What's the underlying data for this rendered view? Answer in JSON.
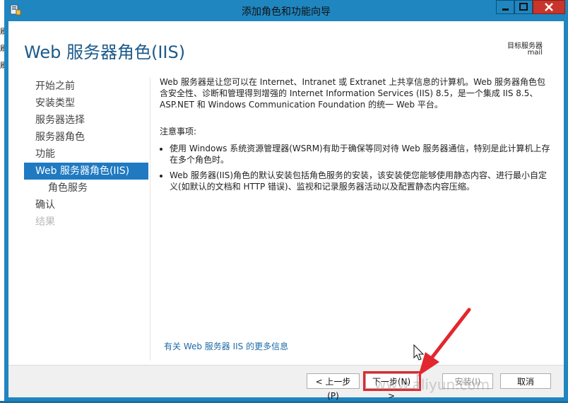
{
  "window": {
    "title": "添加角色和功能向导",
    "icon": "wizard-icon",
    "buttons": [
      "minimize-icon",
      "maximize-icon",
      "close-icon"
    ]
  },
  "desktop": {
    "edge_chars": [
      "刷",
      "刷",
      "刷"
    ]
  },
  "header": {
    "title": "Web 服务器角色(IIS)",
    "destination_label": "目标服务器",
    "destination_value": "mail"
  },
  "nav": {
    "items": [
      {
        "label": "开始之前",
        "state": "normal"
      },
      {
        "label": "安装类型",
        "state": "normal"
      },
      {
        "label": "服务器选择",
        "state": "normal"
      },
      {
        "label": "服务器角色",
        "state": "normal"
      },
      {
        "label": "功能",
        "state": "normal"
      },
      {
        "label": "Web 服务器角色(IIS)",
        "state": "active"
      },
      {
        "label": "角色服务",
        "state": "sub"
      },
      {
        "label": "确认",
        "state": "normal"
      },
      {
        "label": "结果",
        "state": "disabled"
      }
    ]
  },
  "content": {
    "intro": "Web 服务器是让您可以在 Internet、Intranet 或 Extranet 上共享信息的计算机。Web 服务器角色包含安全性、诊断和管理得到增强的 Internet Information Services (IIS) 8.5，是一个集成 IIS 8.5、ASP.NET 和 Windows Communication Foundation 的统一 Web 平台。",
    "notes_heading": "注意事项:",
    "notes": [
      "使用 Windows 系统资源管理器(WSRM)有助于确保等同对待 Web 服务器通信，特别是此计算机上存在多个角色时。",
      "Web 服务器(IIS)角色的默认安装包括角色服务的安装，该安装使您能够使用静态内容、进行最小自定义(如默认的文档和 HTTP 错误)、监视和记录服务器活动以及配置静态内容压缩。"
    ],
    "more_info_link": "有关 Web 服务器 IIS 的更多信息"
  },
  "footer": {
    "prev_label": "< 上一步(P)",
    "next_label": "下一步(N) >",
    "install_label": "安装(I)",
    "cancel_label": "取消"
  },
  "annotation": {
    "highlight_color": "#e2282e"
  },
  "watermark": "www.aliyun.com"
}
